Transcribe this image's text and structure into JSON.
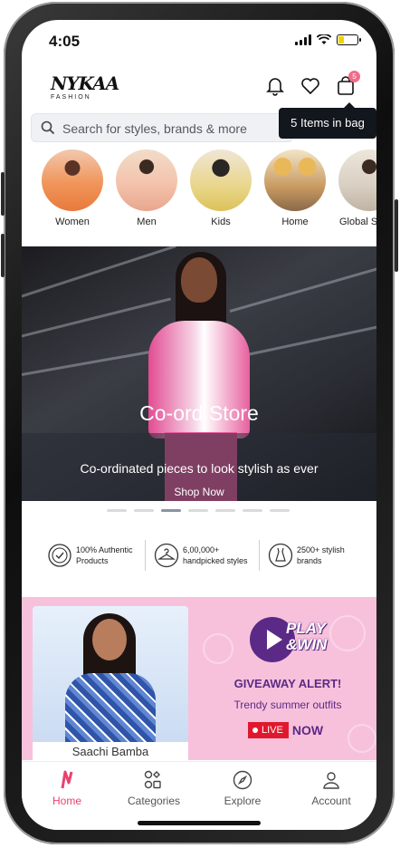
{
  "status_bar": {
    "time": "4:05"
  },
  "header": {
    "logo_brand": "NYKAA",
    "logo_sub": "FASHION",
    "bag_count": "5",
    "bag_tooltip": "5 Items in bag"
  },
  "search": {
    "placeholder": "Search for styles, brands & more"
  },
  "categories": [
    {
      "label": "Women"
    },
    {
      "label": "Men"
    },
    {
      "label": "Kids"
    },
    {
      "label": "Home"
    },
    {
      "label": "Global S"
    }
  ],
  "banner": {
    "title": "Co-ord Store",
    "subtitle": "Co-ordinated pieces to look stylish as ever",
    "cta": "Shop Now",
    "active_slide": 3,
    "slide_count": 7
  },
  "usp": [
    {
      "line1": "100% Authentic",
      "line2": "Products",
      "icon": "badge-check-icon"
    },
    {
      "line1": "6,00,000+",
      "line2": "handpicked styles",
      "icon": "hanger-icon"
    },
    {
      "line1": "2500+ stylish",
      "line2": "brands",
      "icon": "dress-icon"
    }
  ],
  "promo": {
    "person_name": "Saachi Bamba",
    "play_line1": "PLAY",
    "play_line2": "&WIN",
    "headline": "GIVEAWAY ALERT!",
    "subline": "Trendy summer outfits",
    "live_label": "LIVE",
    "now_label": "NOW"
  },
  "bottom_nav": [
    {
      "label": "Home",
      "icon": "nykaa-n-icon",
      "active": true
    },
    {
      "label": "Categories",
      "icon": "categories-icon",
      "active": false
    },
    {
      "label": "Explore",
      "icon": "compass-icon",
      "active": false
    },
    {
      "label": "Account",
      "icon": "person-icon",
      "active": false
    }
  ],
  "colors": {
    "accent": "#e8436f",
    "promo_bg": "#f7c1dc",
    "promo_text": "#5b2a86",
    "live_red": "#e0182d"
  }
}
